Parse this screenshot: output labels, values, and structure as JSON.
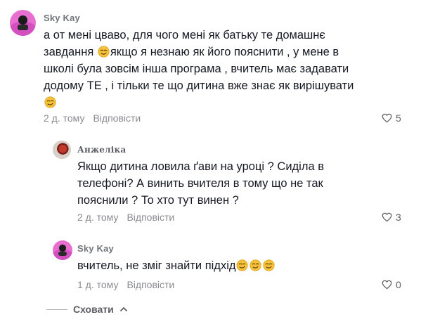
{
  "comments": [
    {
      "username": "Sky Kay",
      "text_parts": [
        "а от мені цваво, для чого мені як батьку те домашнє",
        "завдання ",
        "якщо я незнаю як його пояснити , у мене в",
        "школі була зовсім інша програма , вчитель має задавати",
        "додому ТЕ , і тільки те що дитина вже знає як вирішувати"
      ],
      "time": "2 д. тому",
      "reply_label": "Відповісти",
      "likes": "5"
    },
    {
      "username": "Анжеліка",
      "text_lines": [
        "Якщо дитина ловила ґави на уроці ? Сиділа в",
        "телефоні? А винить вчителя в тому що не так",
        "пояснили ? То хто тут винен ?"
      ],
      "time": "2 д. тому",
      "reply_label": "Відповісти",
      "likes": "3"
    },
    {
      "username": "Sky Kay",
      "text": "вчитель, не зміг знайти підхід",
      "time": "1 д. тому",
      "reply_label": "Відповісти",
      "likes": "0"
    }
  ],
  "collapse_label": "Сховати",
  "icons": {
    "emoji": "smirk-emoji-icon",
    "like": "heart-outline-icon",
    "collapse": "chevron-up-icon"
  },
  "colors": {
    "emoji_face": "#f7c23a",
    "muted": "#8a8b91",
    "text": "#161823"
  }
}
